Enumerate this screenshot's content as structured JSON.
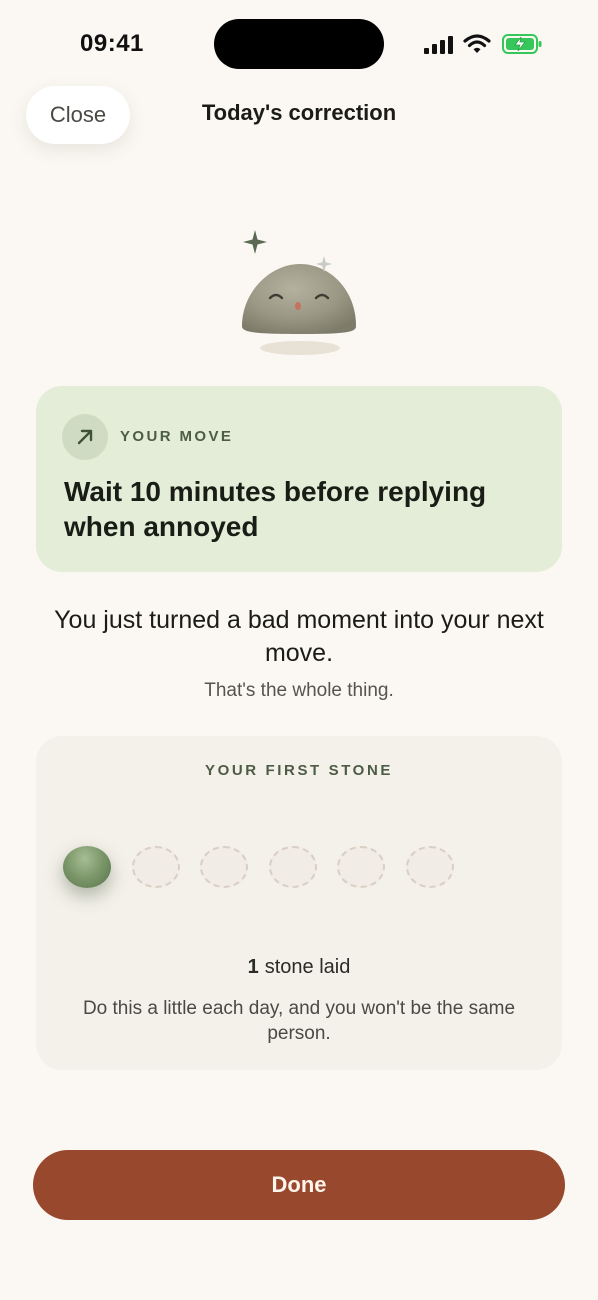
{
  "status_bar": {
    "time": "09:41",
    "icons": [
      "signal-icon",
      "wifi-icon",
      "battery-charging-icon"
    ],
    "battery_color": "#35C759"
  },
  "header": {
    "close_label": "Close",
    "title": "Today's correction"
  },
  "mascot": {
    "icon": "smiling-stone-icon",
    "sparkles": [
      "sparkle-icon",
      "sparkle-icon"
    ]
  },
  "move_card": {
    "icon": "arrow-up-right-icon",
    "kicker": "YOUR MOVE",
    "text": "Wait 10 minutes before replying when annoyed",
    "background": "#E3EDD8"
  },
  "message": {
    "headline": "You just turned a bad moment into your next move.",
    "subline": "That's the whole thing."
  },
  "stones": {
    "kicker": "YOUR FIRST STONE",
    "filled": 1,
    "total": 6,
    "count": "1",
    "count_label": "stone laid",
    "note": "Do this a little each day, and you won't be the same person."
  },
  "done_label": "Done",
  "colors": {
    "background": "#FBF8F3",
    "accent": "#98482D",
    "stone_green": "#7E9A6C"
  }
}
